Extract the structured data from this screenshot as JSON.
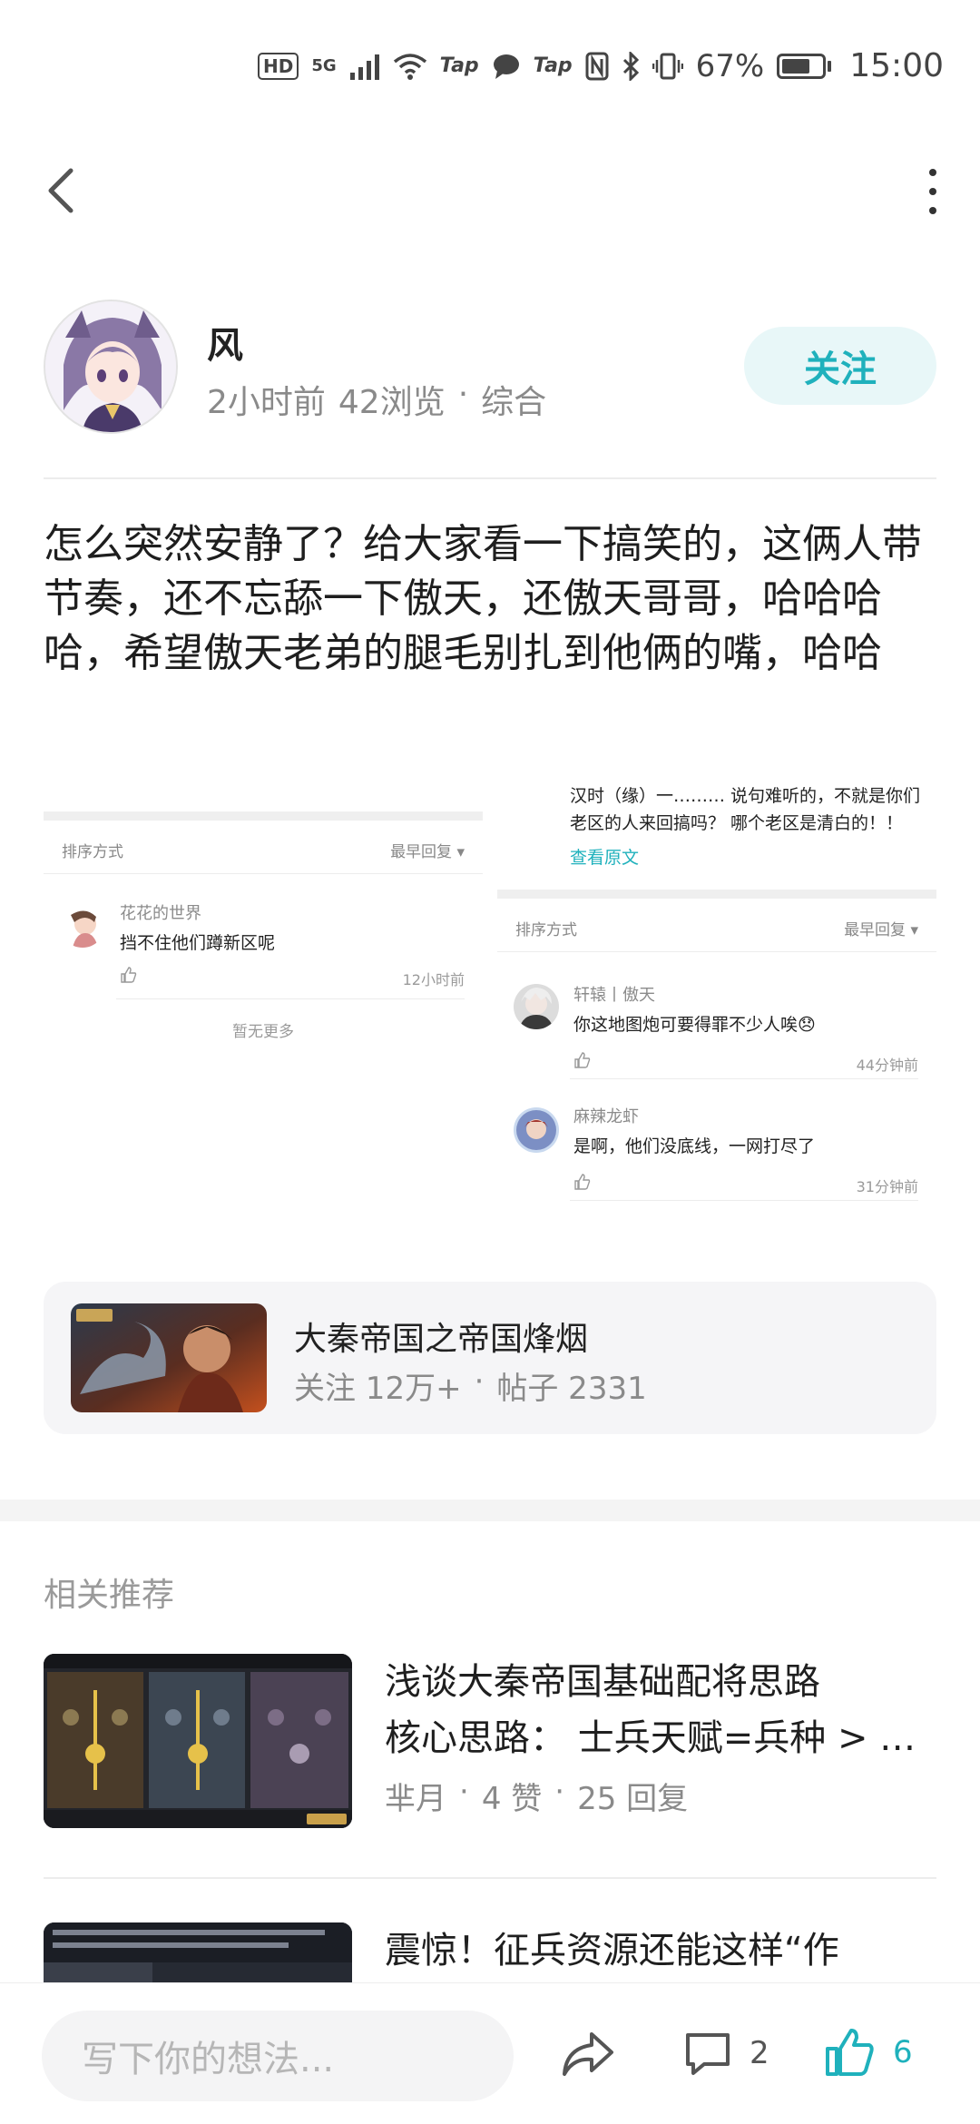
{
  "status_bar": {
    "hd": "HD",
    "network": "5G",
    "tap1": "Tap",
    "tap2": "Tap",
    "battery": "67%",
    "time": "15:00"
  },
  "nav": {
    "back_icon": "chevron-left-icon",
    "more_icon": "more-vertical-icon"
  },
  "author": {
    "name": "风",
    "time_ago": "2小时前",
    "views": "42浏览",
    "separator": "·",
    "category": "综合",
    "follow_label": "关注"
  },
  "post": {
    "text": "怎么突然安静了？给大家看一下搞笑的，这俩人带节奏，还不忘舔一下傲天，还傲天哥哥，哈哈哈哈，希望傲天老弟的腿毛别扎到他俩的嘴，哈哈"
  },
  "screenshot_left": {
    "sort_label": "排序方式",
    "sort_value": "最早回复 ▾",
    "comments": [
      {
        "name": "花花的世界",
        "text": "挡不住他们蹲新区呢",
        "time": "12小时前"
      }
    ],
    "no_more": "暂无更多"
  },
  "screenshot_right": {
    "top_text_line1": "汉时（缘）一……… 说句难听的，不就是你们",
    "top_text_line2": "老区的人来回搞吗？ 哪个老区是清白的！！",
    "view_original": "查看原文",
    "sort_label": "排序方式",
    "sort_value": "最早回复 ▾",
    "comments": [
      {
        "name": "轩辕丨傲天",
        "text": "你这地图炮可要得罪不少人唉😞",
        "time": "44分钟前"
      },
      {
        "name": "麻辣龙虾",
        "text": "是啊，他们没底线，一网打尽了",
        "time": "31分钟前"
      }
    ]
  },
  "game_card": {
    "title": "大秦帝国之帝国烽烟",
    "followers": "关注 12万+",
    "separator": "·",
    "posts": "帖子 2331"
  },
  "related": {
    "title": "相关推荐",
    "items": [
      {
        "title_line1": "浅谈大秦帝国基础配将思路",
        "title_line2": "核心思路：  士兵天赋=兵种 > …",
        "author": "芈月",
        "likes": "4 赞",
        "replies": "25 回复"
      },
      {
        "title_line1": "震惊！征兵资源还能这样“作"
      }
    ]
  },
  "bottom_bar": {
    "input_placeholder": "写下你的想法...",
    "comment_count": "2",
    "like_count": "6"
  },
  "colors": {
    "accent": "#1fb1bc",
    "follow_bg": "#e8f7f8",
    "text_secondary": "#8a8a8a"
  }
}
